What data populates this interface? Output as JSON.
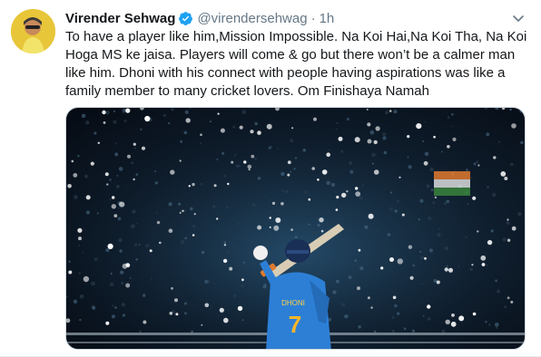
{
  "author": {
    "name": "Virender Sehwag",
    "handle": "@virendersehwag",
    "time": "1h"
  },
  "separator": "·",
  "tweet": {
    "text": "To have a player like him,Mission Impossible. Na Koi Hai,Na Koi Tha, Na Koi Hoga MS ke jaisa. Players will come & go but there won’t be a calmer man like him. Dhoni with his connect with people having aspirations was like a family member to many cricket lovers. Om Finishaya Namah"
  },
  "media": {
    "jersey_name": "DHONI",
    "jersey_number": "7"
  },
  "icons": {
    "verified": "verified-badge-icon",
    "more": "chevron-down-icon"
  },
  "colors": {
    "accent": "#1da1f2",
    "secondary_text": "#657786",
    "jersey": "#2d7fd6"
  }
}
